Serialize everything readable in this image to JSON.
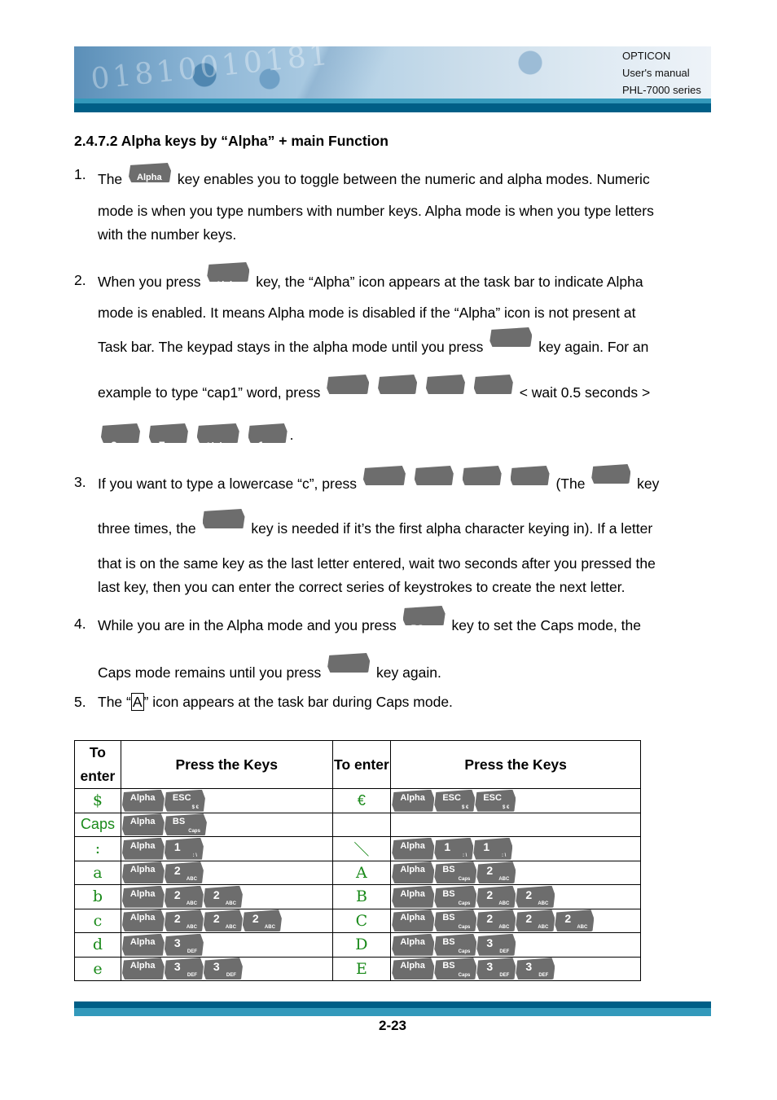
{
  "header": {
    "company": "OPTICON",
    "doc": "User's manual",
    "series": "PHL-7000 series",
    "banner_digits": "01810010181"
  },
  "section_title": "2.4.7.2 Alpha keys by “Alpha” + main Function",
  "keys": {
    "alpha": {
      "main": "Alpha",
      "sub": ""
    },
    "two": {
      "main": "2",
      "sub": "ABC"
    },
    "three": {
      "main": "3",
      "sub": "DEF"
    },
    "seven": {
      "main": "7",
      "sub": "PQRS"
    },
    "one": {
      "main": "1",
      "sub": ": \\"
    },
    "bs": {
      "main": "BS",
      "sub": "Caps"
    },
    "esc": {
      "main": "ESC",
      "sub": "$ €"
    }
  },
  "items": [
    {
      "num": "1.",
      "lines": [
        "The",
        "key enables you to toggle between the numeric and alpha modes. Numeric",
        "mode is when you type numbers with number keys. Alpha mode is when you type letters",
        "with the number keys."
      ]
    },
    {
      "num": "2.",
      "lines": [
        "When you press",
        "key, the “Alpha” icon appears at the task bar to indicate Alpha",
        "mode is enabled. It means Alpha mode is disabled if the “Alpha” icon is not present at",
        "Task bar. The keypad stays in the alpha mode until you press",
        "key again. For an",
        "example to type “cap1” word, press",
        "< wait 0.5 seconds >",
        "."
      ]
    },
    {
      "num": "3.",
      "lines": [
        "If you want to type a lowercase “c”, press",
        "(The",
        "key",
        "three times, the",
        "key is needed if it’s the first alpha character keying in). If a letter",
        "that is on the same key as the last letter entered, wait two seconds after you pressed the",
        "last key, then you can enter the correct series of keystrokes to create the next letter."
      ]
    },
    {
      "num": "4.",
      "lines": [
        "While you are in the Alpha mode and you press",
        "key to set the Caps mode, the",
        "Caps mode remains until you press",
        "key again."
      ]
    },
    {
      "num": "5.",
      "lines": [
        "The “",
        "A",
        "” icon appears at the task bar during Caps mode."
      ]
    }
  ],
  "table": {
    "headers": [
      "To enter",
      "Press the Keys",
      "To enter",
      "Press the Keys"
    ],
    "rows": [
      {
        "left": "$",
        "left_keys": [
          "alpha",
          "esc"
        ],
        "right": "€",
        "right_keys": [
          "alpha",
          "esc",
          "esc"
        ]
      },
      {
        "left": "Caps",
        "left_keys": [
          "alpha",
          "bs"
        ],
        "right": "",
        "right_keys": []
      },
      {
        "left": ":",
        "left_keys": [
          "alpha",
          "one"
        ],
        "right": "＼",
        "right_keys": [
          "alpha",
          "one",
          "one"
        ]
      },
      {
        "left": "a",
        "left_keys": [
          "alpha",
          "two"
        ],
        "right": "A",
        "right_keys": [
          "alpha",
          "bs",
          "two"
        ]
      },
      {
        "left": "b",
        "left_keys": [
          "alpha",
          "two",
          "two"
        ],
        "right": "B",
        "right_keys": [
          "alpha",
          "bs",
          "two",
          "two"
        ]
      },
      {
        "left": "c",
        "left_keys": [
          "alpha",
          "two",
          "two",
          "two"
        ],
        "right": "C",
        "right_keys": [
          "alpha",
          "bs",
          "two",
          "two",
          "two"
        ]
      },
      {
        "left": "d",
        "left_keys": [
          "alpha",
          "three"
        ],
        "right": "D",
        "right_keys": [
          "alpha",
          "bs",
          "three"
        ]
      },
      {
        "left": "e",
        "left_keys": [
          "alpha",
          "three",
          "three"
        ],
        "right": "E",
        "right_keys": [
          "alpha",
          "bs",
          "three",
          "three"
        ]
      }
    ]
  },
  "footer": {
    "page_number": "2-23"
  }
}
